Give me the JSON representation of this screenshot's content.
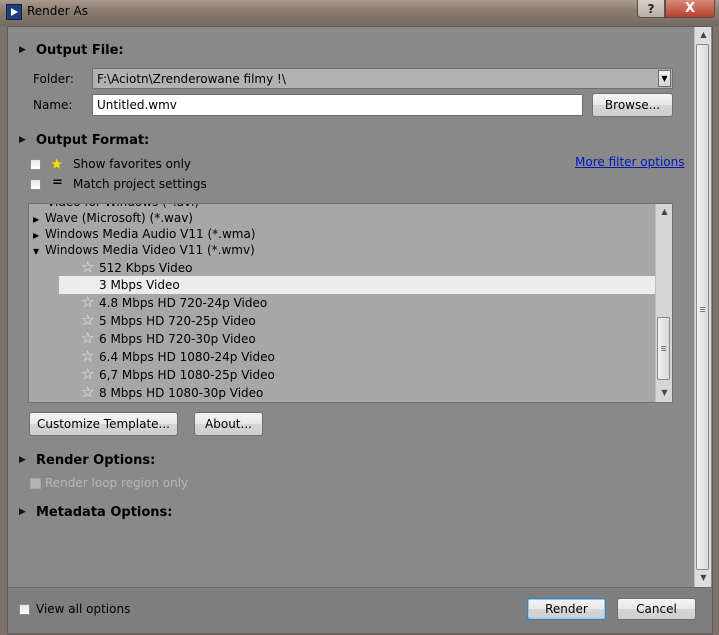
{
  "window": {
    "title": "Render As",
    "help_label": "?",
    "close_label": "X"
  },
  "output_file": {
    "header": "Output File:",
    "folder_label": "Folder:",
    "folder_value": "F:\\Aciotn\\Zrenderowane filmy !\\",
    "name_label": "Name:",
    "name_value": "Untitled.wmv",
    "browse_label": "Browse..."
  },
  "output_format": {
    "header": "Output Format:",
    "show_favorites_label": "Show favorites only",
    "match_project_label": "Match project settings",
    "more_filter_label": "More filter options",
    "cut_row_label": "Video for Windows (*.avi)",
    "groups": [
      {
        "label": "Wave (Microsoft) (*.wav)"
      },
      {
        "label": "Windows Media Audio V11 (*.wma)"
      },
      {
        "label": "Windows Media Video V11 (*.wmv)"
      }
    ],
    "templates": [
      {
        "label": "512 Kbps Video"
      },
      {
        "label": "3 Mbps Video"
      },
      {
        "label": "4.8 Mbps HD 720-24p Video"
      },
      {
        "label": "5 Mbps HD 720-25p Video"
      },
      {
        "label": "6 Mbps HD 720-30p Video"
      },
      {
        "label": "6.4 Mbps HD 1080-24p Video"
      },
      {
        "label": "6,7 Mbps HD 1080-25p Video"
      },
      {
        "label": "8 Mbps HD 1080-30p Video"
      }
    ],
    "selected_template": "3 Mbps Video",
    "customize_label": "Customize Template...",
    "about_label": "About..."
  },
  "render_options": {
    "header": "Render Options:",
    "loop_region_label": "Render loop region only"
  },
  "metadata_options": {
    "header": "Metadata Options:"
  },
  "footer": {
    "view_all_label": "View all options",
    "render_label": "Render",
    "cancel_label": "Cancel"
  },
  "icons": {
    "favorite": "star-icon",
    "match": "equals-icon",
    "expand": "triangle-right-icon",
    "collapse": "triangle-down-icon"
  },
  "colors": {
    "link": "#0018c4",
    "favorite_star": "#f2e010",
    "primary_button_border": "#3c7fb1"
  }
}
